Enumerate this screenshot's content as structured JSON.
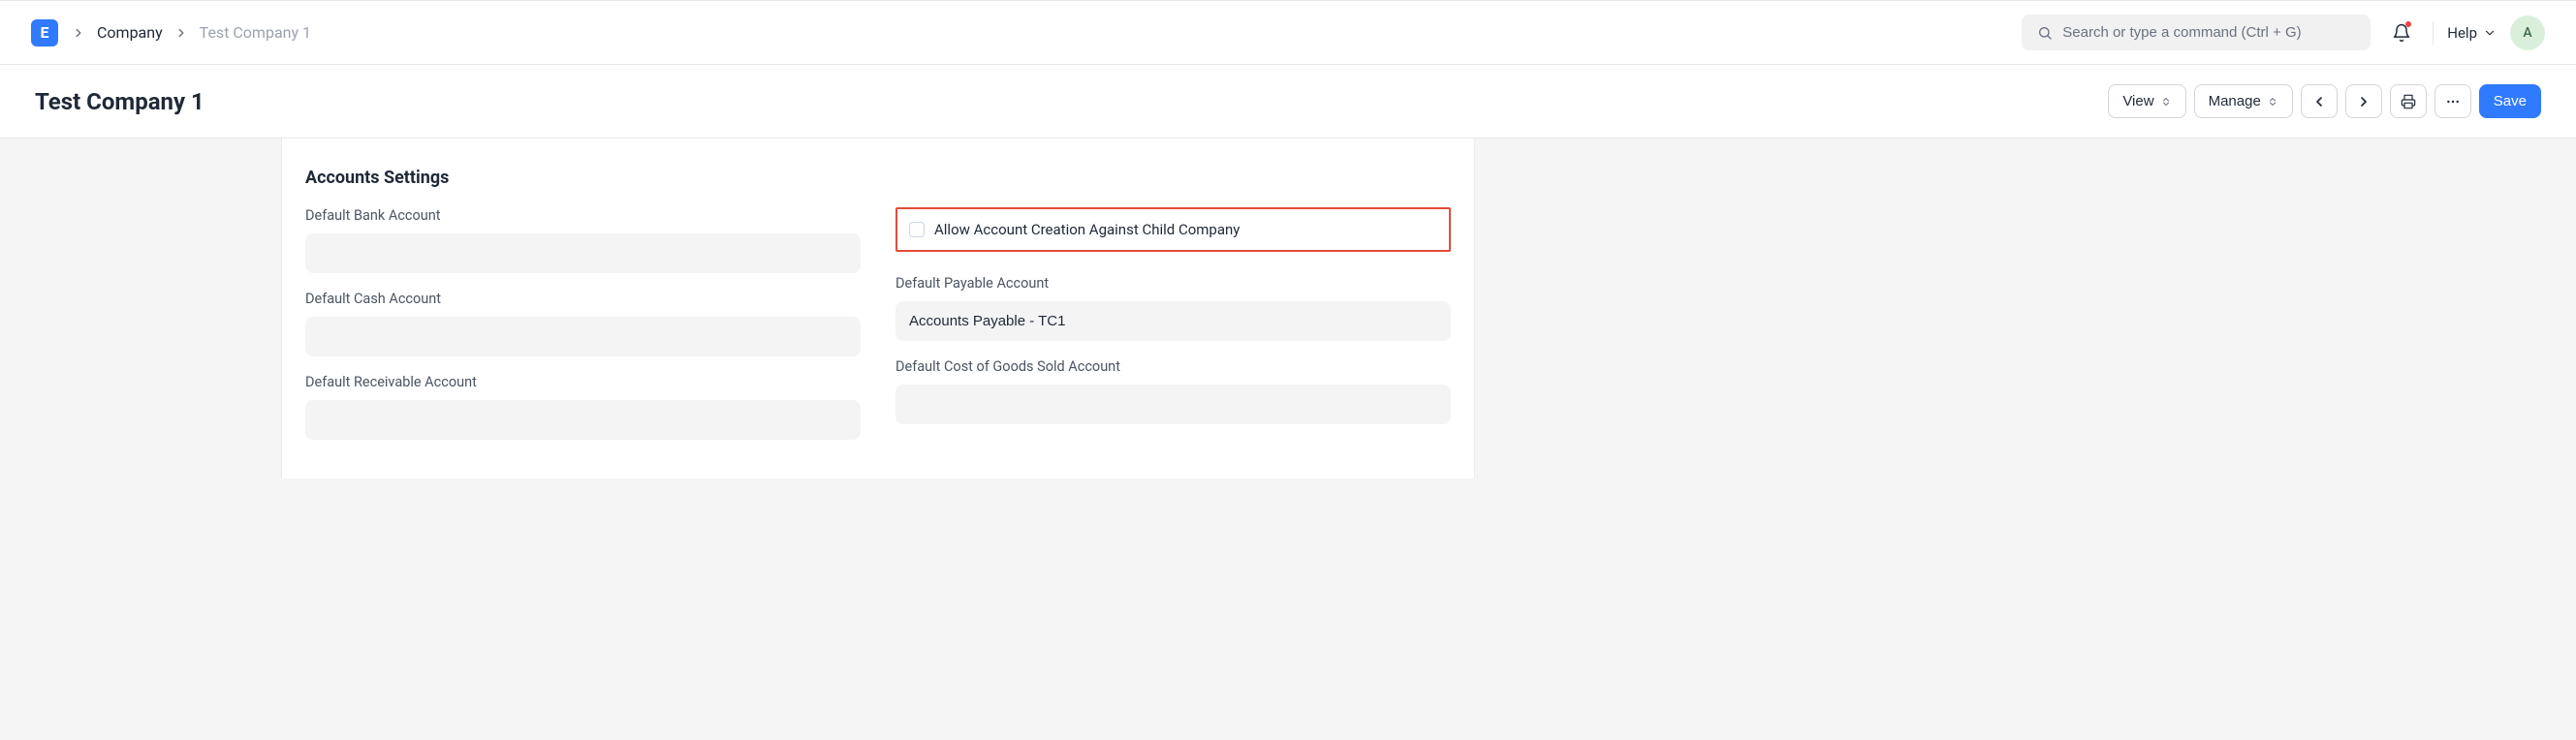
{
  "logo": "E",
  "breadcrumb": {
    "parent": "Company",
    "current": "Test Company 1"
  },
  "search": {
    "placeholder": "Search or type a command (Ctrl + G)"
  },
  "help_label": "Help",
  "avatar_letter": "A",
  "page_title": "Test Company 1",
  "toolbar": {
    "view": "View",
    "manage": "Manage",
    "save": "Save"
  },
  "section": {
    "title": "Accounts Settings",
    "left": {
      "default_bank_label": "Default Bank Account",
      "default_bank_value": "",
      "default_cash_label": "Default Cash Account",
      "default_cash_value": "",
      "default_receivable_label": "Default Receivable Account",
      "default_receivable_value": ""
    },
    "right": {
      "allow_child_label": "Allow Account Creation Against Child Company",
      "default_payable_label": "Default Payable Account",
      "default_payable_value": "Accounts Payable - TC1",
      "default_cogs_label": "Default Cost of Goods Sold Account",
      "default_cogs_value": ""
    }
  }
}
